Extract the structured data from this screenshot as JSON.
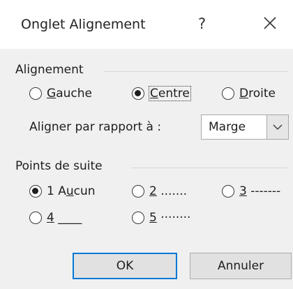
{
  "dialog": {
    "title": "Onglet Alignement",
    "help_label": "?",
    "close_icon": "close-icon"
  },
  "alignment": {
    "group_label": "Alignement",
    "options": [
      {
        "prefix": "",
        "accel": "G",
        "rest": "auche",
        "checked": false
      },
      {
        "prefix": "",
        "accel": "C",
        "rest": "entre",
        "checked": true
      },
      {
        "prefix": "",
        "accel": "D",
        "rest": "roite",
        "checked": false
      }
    ],
    "relative_label": "Aligner par rapport à :",
    "relative_value": "Marge"
  },
  "leader": {
    "group_label": "Points de suite",
    "options": [
      {
        "prefix": "1 A",
        "accel": "u",
        "rest": "cun",
        "checked": true
      },
      {
        "prefix": "",
        "accel": "2",
        "rest": " .......",
        "checked": false
      },
      {
        "prefix": "",
        "accel": "3",
        "rest": " -------",
        "checked": false
      },
      {
        "prefix": "",
        "accel": "4",
        "rest": " ____",
        "checked": false
      },
      {
        "prefix": "",
        "accel": "5",
        "rest": " ········",
        "checked": false
      }
    ]
  },
  "buttons": {
    "ok_label": "OK",
    "cancel_label": "Annuler"
  }
}
